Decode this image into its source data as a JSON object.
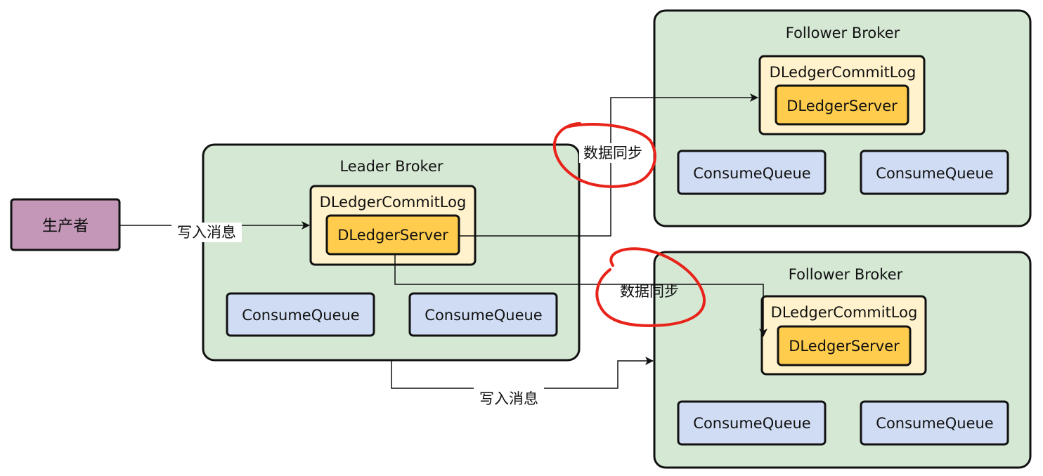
{
  "producer": {
    "label": "生产者"
  },
  "leader": {
    "title": "Leader Broker",
    "commitlog_label": "DLedgerCommitLog",
    "server_label": "DLedgerServer",
    "queues": [
      "ConsumeQueue",
      "ConsumeQueue"
    ]
  },
  "followers": [
    {
      "title": "Follower Broker",
      "commitlog_label": "DLedgerCommitLog",
      "server_label": "DLedgerServer",
      "queues": [
        "ConsumeQueue",
        "ConsumeQueue"
      ]
    },
    {
      "title": "Follower Broker",
      "commitlog_label": "DLedgerCommitLog",
      "server_label": "DLedgerServer",
      "queues": [
        "ConsumeQueue",
        "ConsumeQueue"
      ]
    }
  ],
  "edges": {
    "producer_to_leader": "写入消息",
    "leader_to_follower_bottom": "写入消息",
    "sync_top": "数据同步",
    "sync_bottom": "数据同步"
  },
  "colors": {
    "broker_fill": "#d5e8d4",
    "commitlog_fill": "#fff2cc",
    "server_fill": "#ffcc4d",
    "queue_fill": "#cfdcf3",
    "producer_fill": "#c497b8",
    "annotation_stroke": "#e8231a",
    "stroke": "#111111"
  }
}
